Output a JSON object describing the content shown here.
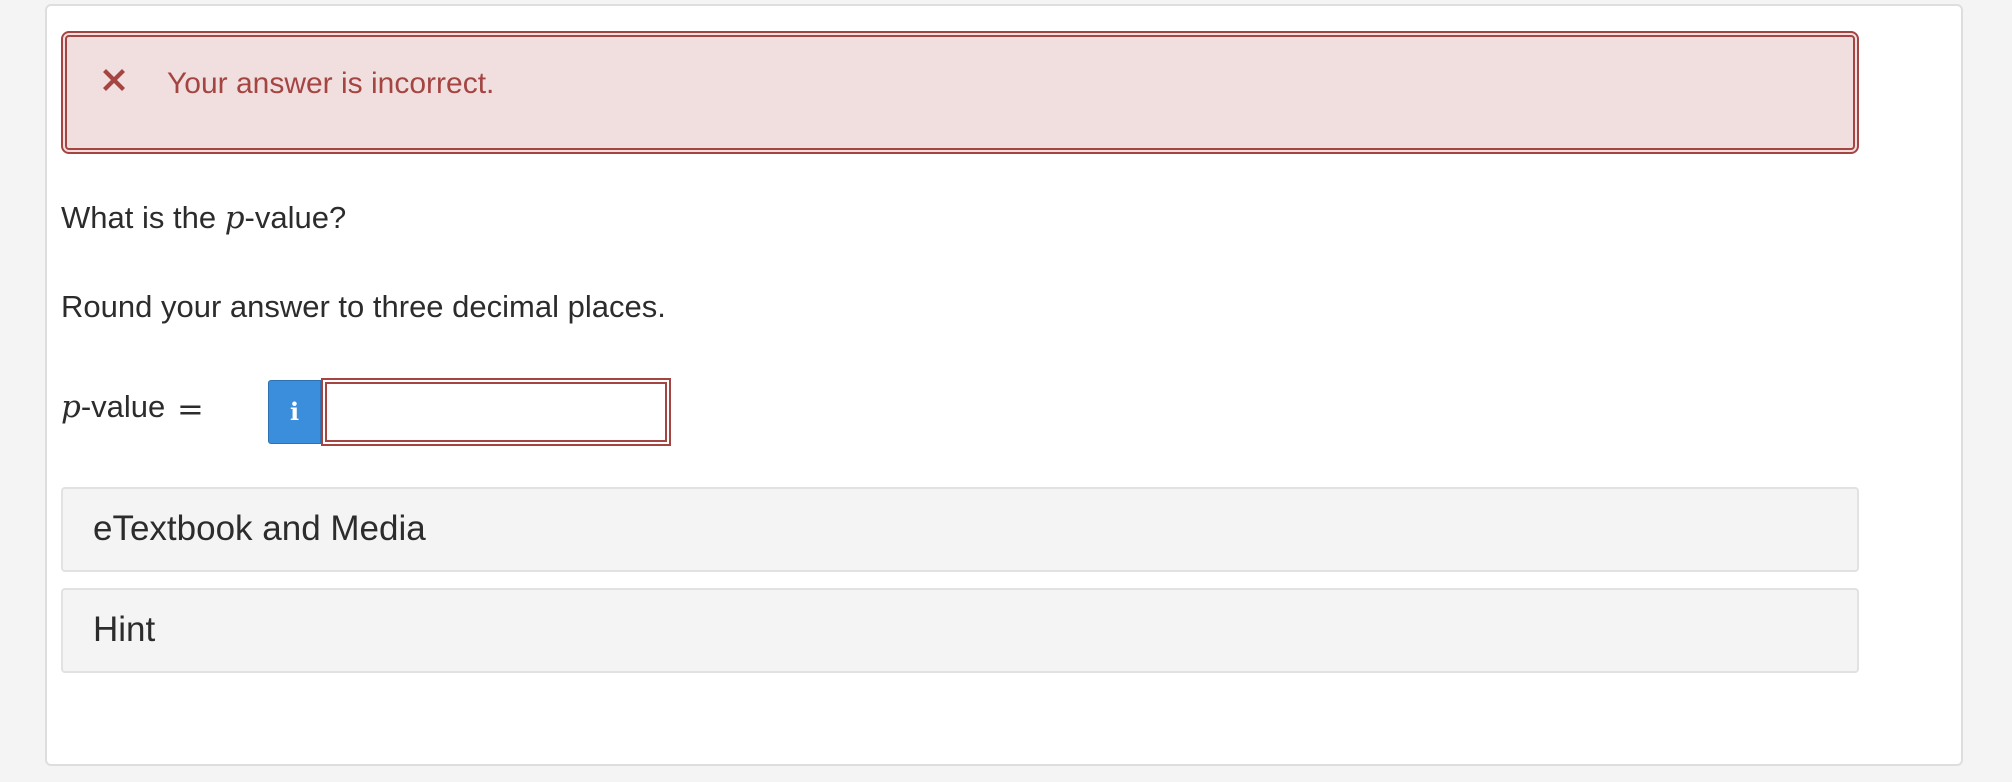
{
  "feedback": {
    "icon": "close-x-icon",
    "message": "Your answer is incorrect.",
    "color": "#a44542",
    "background": "#f1dfe0"
  },
  "question": {
    "text_before": "What is the ",
    "math_symbol": "p",
    "text_after": "-value?"
  },
  "instruction": "Round your answer to three decimal places.",
  "answer": {
    "label_symbol": "p",
    "label_text": "-value",
    "equals": "=",
    "info_icon_glyph": "i",
    "info_icon_name": "info-icon",
    "info_color": "#3a8edb",
    "value": ""
  },
  "accordions": {
    "etextbook": "eTextbook and Media",
    "hint": "Hint"
  }
}
